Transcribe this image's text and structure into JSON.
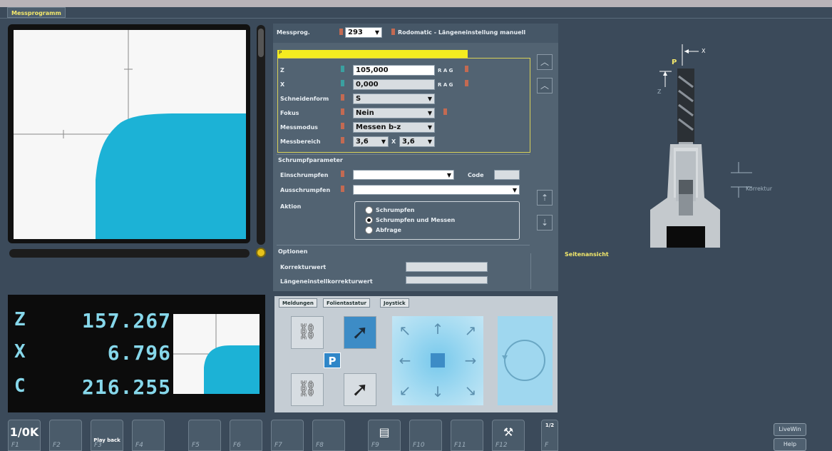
{
  "window": {
    "tab_title": "Messprogramm"
  },
  "viewer": {},
  "readout": {
    "axes": [
      {
        "name": "Z",
        "value": "157.267"
      },
      {
        "name": "X",
        "value": "6.796"
      },
      {
        "name": "C",
        "value": "216.255"
      }
    ]
  },
  "program": {
    "label": "Messprog.",
    "number": "293",
    "description": "Rodomatic - Längeneinstellung manuell"
  },
  "params": {
    "yellow_label": "P",
    "z_label": "Z",
    "z_value": "105,000",
    "z_rag": "R A G",
    "x_label": "X",
    "x_value": "0,000",
    "x_rag": "R A G",
    "schneidenform_label": "Schneidenform",
    "schneidenform_value": "S",
    "fokus_label": "Fokus",
    "fokus_value": "Nein",
    "messmodus_label": "Messmodus",
    "messmodus_value": "Messen b-z",
    "messbereich_label": "Messbereich",
    "messbereich_a": "3,6",
    "messbereich_sep": "X",
    "messbereich_b": "3,6"
  },
  "schrumpf": {
    "title": "Schrumpfparameter",
    "einschrumpfen_label": "Einschrumpfen",
    "code_label": "Code",
    "ausschrumpfen_label": "Ausschrumpfen",
    "aktion_label": "Aktion",
    "options": [
      "Schrumpfen",
      "Schrumpfen und Messen",
      "Abfrage"
    ],
    "selected_index": 1
  },
  "optionen": {
    "title": "Optionen",
    "korrekturwert_label": "Korrekturwert",
    "laengen_label": "Längeneinstellkorrekturwert"
  },
  "joystick_panel": {
    "tabs": [
      "Meldungen",
      "Folientastatur",
      "Joystick"
    ],
    "p_label": "P"
  },
  "sideview": {
    "label": "Seitenansicht",
    "x_label": "X",
    "z_label": "Z",
    "p_label": "P",
    "korrektur_label": "Korrektur"
  },
  "fkeys": [
    {
      "label": "F1",
      "icon": "1/0K"
    },
    {
      "label": "F2",
      "icon": ""
    },
    {
      "label": "F3",
      "icon": "Play back"
    },
    {
      "label": "F4",
      "icon": ""
    },
    {
      "label": "F5",
      "icon": ""
    },
    {
      "label": "F6",
      "icon": ""
    },
    {
      "label": "F7",
      "icon": ""
    },
    {
      "label": "F8",
      "icon": ""
    },
    {
      "label": "F9",
      "icon": ""
    },
    {
      "label": "F10",
      "icon": ""
    },
    {
      "label": "F11",
      "icon": ""
    },
    {
      "label": "F12",
      "icon": ""
    },
    {
      "label": "F",
      "icon": "1/2"
    }
  ],
  "side_buttons": {
    "livewin": "LiveWin",
    "help": "Help"
  },
  "colors": {
    "background": "#3b4a5a",
    "accent_cyan": "#1cb2d6",
    "highlight_yellow": "#f4ec20",
    "readout_text": "#86d7ea"
  }
}
